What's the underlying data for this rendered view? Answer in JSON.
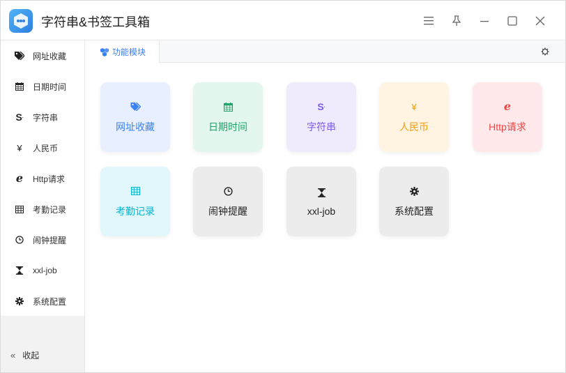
{
  "app": {
    "title": "字符串&书签工具箱"
  },
  "colors": {
    "accent": "#3b82f6",
    "blue_bg": "#e8efff",
    "blue_fg": "#3b82f6",
    "green_bg": "#e3f7ef",
    "green_fg": "#1aa66b",
    "purple_bg": "#efebfd",
    "purple_fg": "#7c5ce6",
    "orange_bg": "#fff3e2",
    "orange_fg": "#f59e0b",
    "red_bg": "#ffe9ea",
    "red_fg": "#ef4444",
    "cyan_bg": "#e2f7fb",
    "cyan_fg": "#06b6d4",
    "gray_bg": "#ececec",
    "gray_fg": "#222222"
  },
  "sidebar": {
    "items": [
      {
        "label": "网址收藏",
        "icon": "tags-icon"
      },
      {
        "label": "日期时间",
        "icon": "calendar-icon"
      },
      {
        "label": "字符串",
        "icon": "s-dollar-icon"
      },
      {
        "label": "人民币",
        "icon": "yen-icon"
      },
      {
        "label": "Http请求",
        "icon": "ie-icon"
      },
      {
        "label": "考勤记录",
        "icon": "table-icon"
      },
      {
        "label": "闹钟提醒",
        "icon": "clock-icon"
      },
      {
        "label": "xxl-job",
        "icon": "hourglass-icon"
      },
      {
        "label": "系统配置",
        "icon": "gear-icon"
      }
    ],
    "collapse_label": "收起"
  },
  "tabs": [
    {
      "label": "功能模块",
      "icon": "cubes-icon"
    }
  ],
  "cards": [
    {
      "label": "网址收藏",
      "icon": "tags-icon",
      "theme": "blue"
    },
    {
      "label": "日期时间",
      "icon": "calendar-icon",
      "theme": "green"
    },
    {
      "label": "字符串",
      "icon": "s-dollar-icon",
      "theme": "purple"
    },
    {
      "label": "人民币",
      "icon": "yen-icon",
      "theme": "orange"
    },
    {
      "label": "Http请求",
      "icon": "ie-icon",
      "theme": "red"
    },
    {
      "label": "考勤记录",
      "icon": "table-icon",
      "theme": "cyan"
    },
    {
      "label": "闹钟提醒",
      "icon": "clock-icon",
      "theme": "gray"
    },
    {
      "label": "xxl-job",
      "icon": "hourglass-icon",
      "theme": "gray"
    },
    {
      "label": "系统配置",
      "icon": "gear-icon",
      "theme": "gray"
    }
  ]
}
